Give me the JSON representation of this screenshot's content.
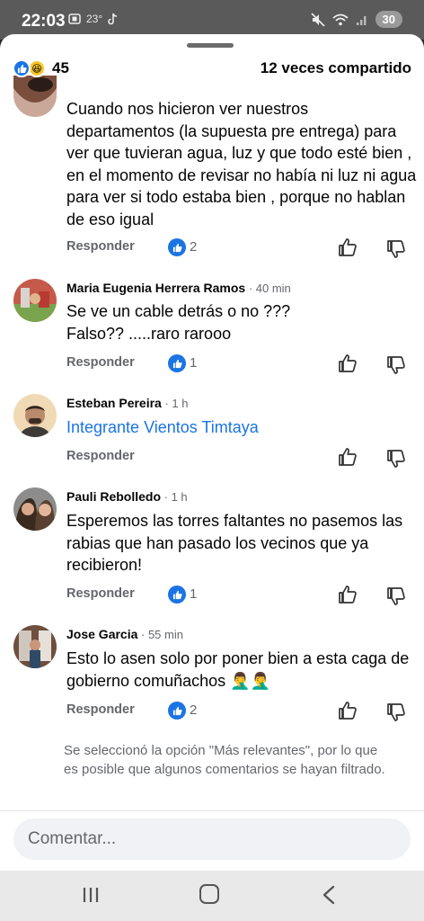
{
  "status_bar": {
    "time": "22:03",
    "temperature": "23°",
    "battery": "30"
  },
  "summary": {
    "reaction_count": "45",
    "share_count": "12 veces compartido"
  },
  "comments": [
    {
      "author": "",
      "time": "",
      "text": "Cuando nos hicieron ver nuestros departamentos (la supuesta pre entrega) para ver que tuvieran agua, luz y que todo esté bien , en el momento de revisar no había ni luz ni agua para ver si todo estaba bien , porque no hablan de eso igual",
      "likes": "2",
      "reply_label": "Responder"
    },
    {
      "author": "Maria Eugenia Herrera Ramos",
      "time": " · 40 min",
      "text": "Se ve un cable detrás o no ???\nFalso?? .....raro rarooo",
      "likes": "1",
      "reply_label": "Responder"
    },
    {
      "author": "Esteban Pereira",
      "time": " · 1 h",
      "text": "Integrante Vientos Timtaya",
      "likes": "",
      "reply_label": "Responder"
    },
    {
      "author": "Pauli Rebolledo",
      "time": " · 1 h",
      "text": "Esperemos las torres faltantes no pasemos las rabias que han pasado los vecinos que ya recibieron!",
      "likes": "1",
      "reply_label": "Responder"
    },
    {
      "author": "Jose Garcia",
      "time": " · 55 min",
      "text": "Esto lo asen solo por poner bien a esta caga de gobierno comuñachos 🤦‍♂️🤦‍♂️",
      "likes": "2",
      "reply_label": "Responder"
    }
  ],
  "notice": "Se seleccionó la opción \"Más relevantes\", por lo que es posible que algunos comentarios se hayan filtrado.",
  "composer": {
    "placeholder": "Comentar..."
  },
  "colors": {
    "accent": "#1b74e4",
    "secondary_text": "#65676b"
  }
}
